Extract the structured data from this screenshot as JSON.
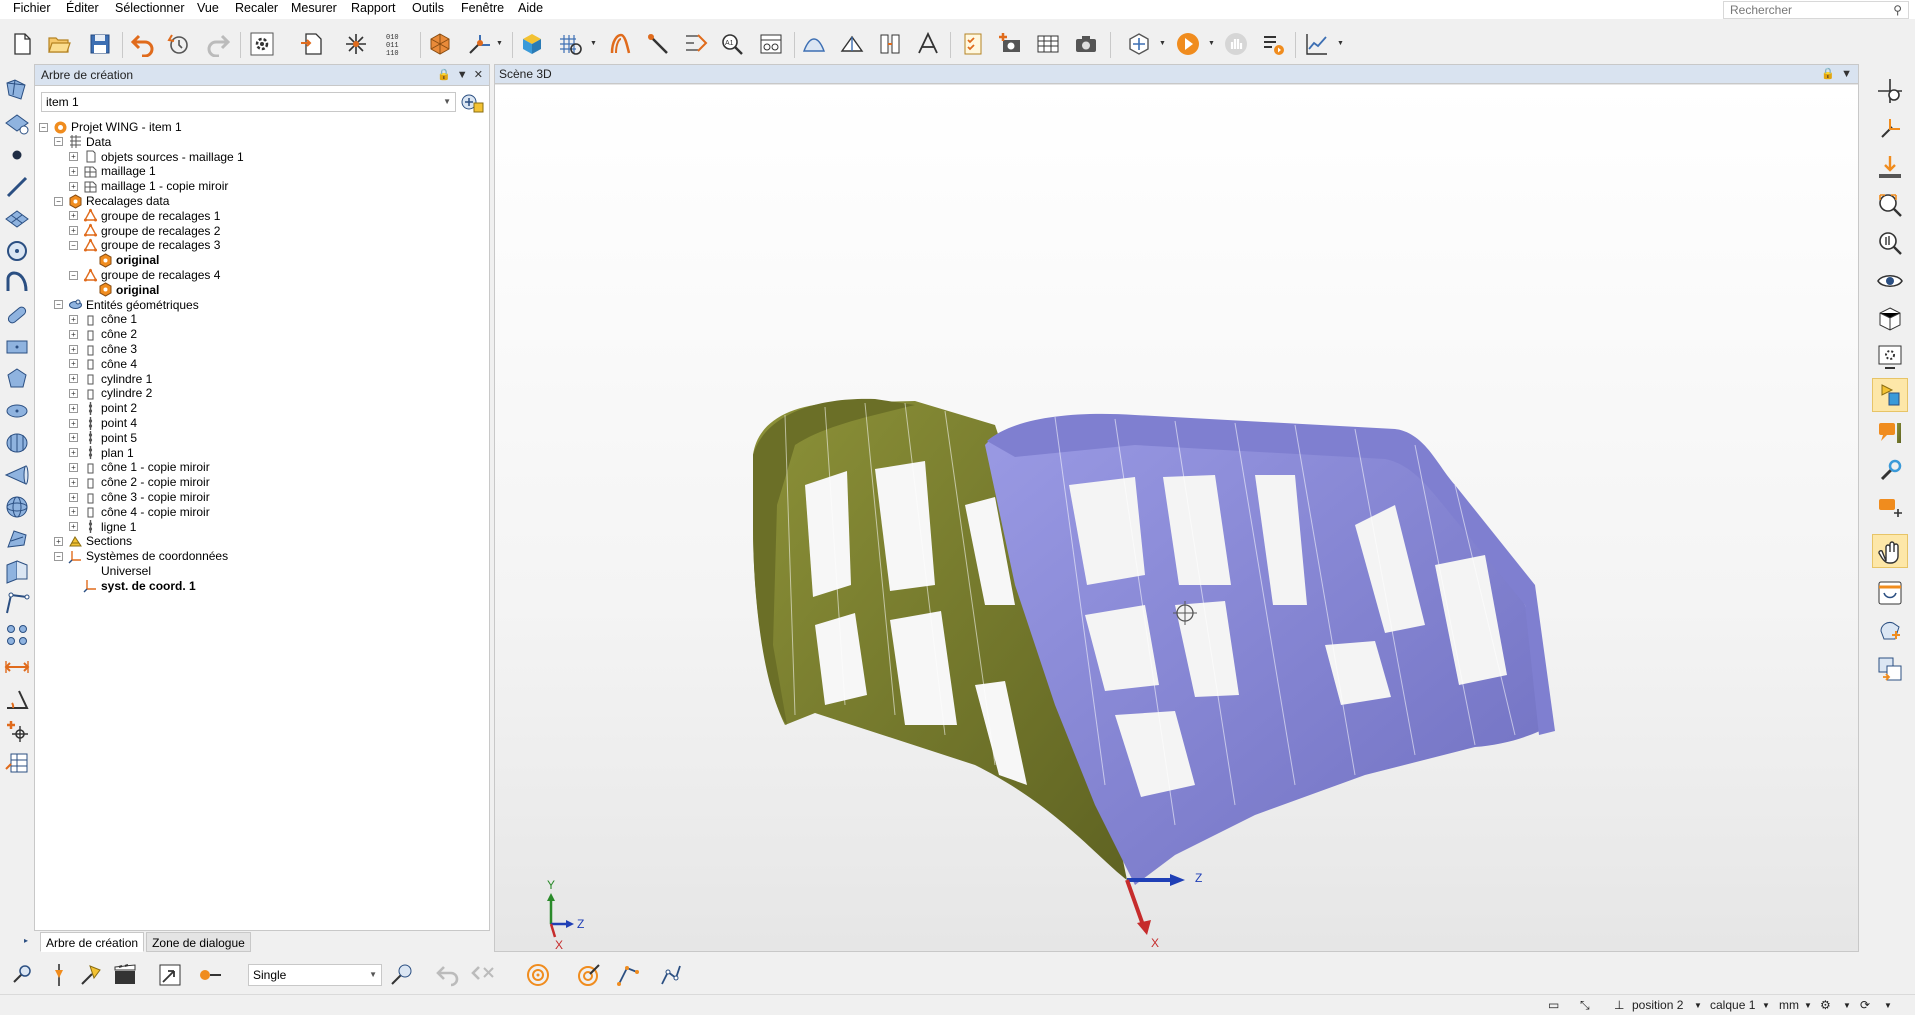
{
  "menu": [
    "Fichier",
    "Éditer",
    "Sélectionner",
    "Vue",
    "Recaler",
    "Mesurer",
    "Rapport",
    "Outils",
    "Fenêtre",
    "Aide"
  ],
  "search": {
    "placeholder": "Rechercher"
  },
  "tree_panel": {
    "title": "Arbre de création",
    "item_select": "item 1",
    "rows": [
      {
        "label": "Projet WING - item 1",
        "bold": false
      },
      {
        "label": "Data",
        "bold": false
      },
      {
        "label": "objets sources - maillage 1",
        "bold": false
      },
      {
        "label": "maillage 1",
        "bold": false
      },
      {
        "label": "maillage 1 - copie miroir",
        "bold": false
      },
      {
        "label": "Recalages data",
        "bold": false
      },
      {
        "label": "groupe de recalages 1",
        "bold": false
      },
      {
        "label": "groupe de recalages 2",
        "bold": false
      },
      {
        "label": "groupe de recalages 3",
        "bold": false
      },
      {
        "label": "original",
        "bold": true
      },
      {
        "label": "groupe de recalages 4",
        "bold": false
      },
      {
        "label": "original",
        "bold": true
      },
      {
        "label": "Entités géométriques",
        "bold": false
      },
      {
        "label": "cône 1",
        "bold": false
      },
      {
        "label": "cône 2",
        "bold": false
      },
      {
        "label": "cône 3",
        "bold": false
      },
      {
        "label": "cône 4",
        "bold": false
      },
      {
        "label": "cylindre 1",
        "bold": false
      },
      {
        "label": "cylindre 2",
        "bold": false
      },
      {
        "label": "point 2",
        "bold": false
      },
      {
        "label": "point 4",
        "bold": false
      },
      {
        "label": "point 5",
        "bold": false
      },
      {
        "label": "plan 1",
        "bold": false
      },
      {
        "label": "cône 1 - copie miroir",
        "bold": false
      },
      {
        "label": "cône 2 - copie miroir",
        "bold": false
      },
      {
        "label": "cône 3 - copie miroir",
        "bold": false
      },
      {
        "label": "cône 4 - copie miroir",
        "bold": false
      },
      {
        "label": "ligne 1",
        "bold": false
      },
      {
        "label": "Sections",
        "bold": false
      },
      {
        "label": "Systèmes de coordonnées",
        "bold": false
      },
      {
        "label": "Universel",
        "bold": false
      },
      {
        "label": "syst. de coord. 1",
        "bold": true
      }
    ],
    "tabs": [
      "Arbre de création",
      "Zone de dialogue"
    ]
  },
  "scene": {
    "title": "Scène 3D",
    "triad_labels": {
      "y": "Y",
      "z": "Z",
      "x": "X"
    },
    "axis_labels": {
      "z": "Z",
      "x": "X"
    },
    "colors": {
      "mesh_original": "#7b7f2e",
      "mesh_mirror": "#8585d6",
      "axis_z": "#1f3fb6",
      "axis_x": "#c62c2c"
    }
  },
  "bottom": {
    "mode_select": "Single"
  },
  "status": {
    "position": "position 2",
    "layer": "calque 1",
    "unit": "mm"
  }
}
